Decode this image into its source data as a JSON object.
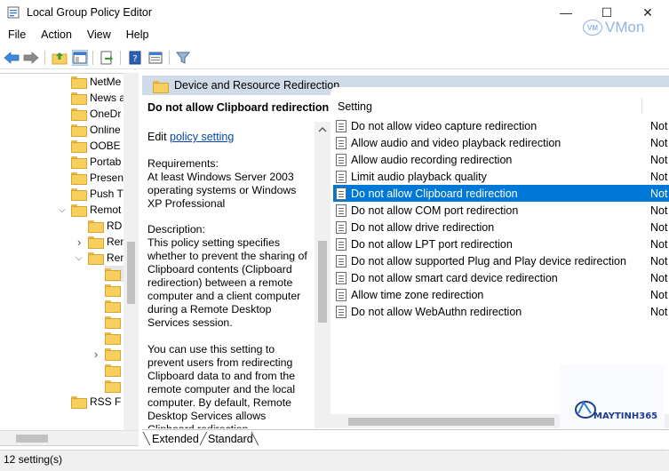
{
  "window": {
    "title": "Local Group Policy Editor",
    "minimize_glyph": "—",
    "maximize_glyph": "☐",
    "close_glyph": "✕"
  },
  "brand_overlay": {
    "badge": "VM",
    "text": "VMon"
  },
  "menu": [
    "File",
    "Action",
    "View",
    "Help"
  ],
  "toolbar": {
    "icons": [
      "back-arrow-icon",
      "forward-arrow-icon",
      "up-folder-icon",
      "show-hide-tree-icon",
      "export-list-icon",
      "help-icon",
      "properties-icon",
      "filter-icon"
    ]
  },
  "tree": {
    "items": [
      {
        "label": "NetMe",
        "indent": 0
      },
      {
        "label": "News a",
        "indent": 0
      },
      {
        "label": "OneDr",
        "indent": 0
      },
      {
        "label": "Online",
        "indent": 0
      },
      {
        "label": "OOBE",
        "indent": 0
      },
      {
        "label": "Portab",
        "indent": 0
      },
      {
        "label": "Presen",
        "indent": 0
      },
      {
        "label": "Push T",
        "indent": 0
      },
      {
        "label": "Remot",
        "indent": 0,
        "expanded": true
      },
      {
        "label": "RD",
        "indent": 1
      },
      {
        "label": "Ren",
        "indent": 1,
        "collapsed": true
      },
      {
        "label": "Ren",
        "indent": 1,
        "expanded": true
      },
      {
        "label": "",
        "indent": 2,
        "selected": true
      },
      {
        "label": "",
        "indent": 2
      },
      {
        "label": "",
        "indent": 2
      },
      {
        "label": "",
        "indent": 2
      },
      {
        "label": "",
        "indent": 2
      },
      {
        "label": "",
        "indent": 2,
        "collapsed": true
      },
      {
        "label": "",
        "indent": 2
      },
      {
        "label": "",
        "indent": 2
      },
      {
        "label": "RSS F",
        "indent": 0,
        "partial": true
      }
    ]
  },
  "breadcrumb": "Device and Resource Redirection",
  "description": {
    "title": "Do not allow Clipboard redirection",
    "edit_prefix": "Edit",
    "edit_link": "policy setting",
    "requirements_label": "Requirements:",
    "requirements_text": "At least Windows Server 2003 operating systems or Windows XP Professional",
    "description_label": "Description:",
    "description_text": "This policy setting specifies whether to prevent the sharing of Clipboard contents (Clipboard redirection) between a remote computer and a client computer during a Remote Desktop Services session.",
    "more_text": "You can use this setting to prevent users from redirecting Clipboard data to and from the remote computer and the local computer. By default, Remote Desktop Services allows Clipboard redirection."
  },
  "list": {
    "column_setting": "Setting",
    "rows": [
      {
        "name": "Do not allow video capture redirection",
        "state": "Not"
      },
      {
        "name": "Allow audio and video playback redirection",
        "state": "Not"
      },
      {
        "name": "Allow audio recording redirection",
        "state": "Not"
      },
      {
        "name": "Limit audio playback quality",
        "state": "Not"
      },
      {
        "name": "Do not allow Clipboard redirection",
        "state": "Not",
        "selected": true
      },
      {
        "name": "Do not allow COM port redirection",
        "state": "Not"
      },
      {
        "name": "Do not allow drive redirection",
        "state": "Not"
      },
      {
        "name": "Do not allow LPT port redirection",
        "state": "Not"
      },
      {
        "name": "Do not allow supported Plug and Play device redirection",
        "state": "Not"
      },
      {
        "name": "Do not allow smart card device redirection",
        "state": "Not"
      },
      {
        "name": "Allow time zone redirection",
        "state": "Not"
      },
      {
        "name": "Do not allow WebAuthn redirection",
        "state": "Not"
      }
    ]
  },
  "tabs": [
    "Extended",
    "Standard"
  ],
  "status": "12 setting(s)",
  "watermark": {
    "text": "MAYTINH365"
  },
  "colors": {
    "selection": "#0078d7",
    "header_bar": "#cfdbe9",
    "link": "#0645ad"
  }
}
